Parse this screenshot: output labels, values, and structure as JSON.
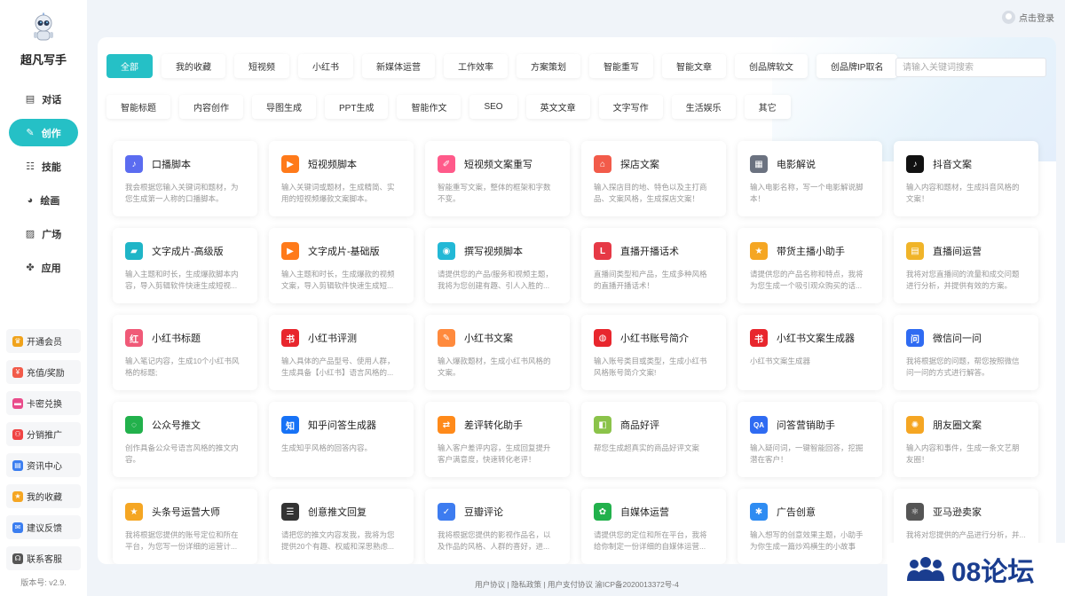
{
  "app": {
    "name": "超凡写手",
    "version": "版本号: v2.9."
  },
  "nav": [
    {
      "label": "对话",
      "icon": "chat-icon",
      "glyph": "▤"
    },
    {
      "label": "创作",
      "icon": "pen-icon",
      "glyph": "✎"
    },
    {
      "label": "技能",
      "icon": "skill-list-icon",
      "glyph": "☷"
    },
    {
      "label": "绘画",
      "icon": "palette-icon",
      "glyph": "◕"
    },
    {
      "label": "广场",
      "icon": "image-icon",
      "glyph": "▨"
    },
    {
      "label": "应用",
      "icon": "apps-icon",
      "glyph": "✤"
    }
  ],
  "side_items": [
    {
      "label": "开通会员",
      "icon": "crown-icon",
      "color": "#f0a31c",
      "glyph": "♛"
    },
    {
      "label": "充值/奖励",
      "icon": "recharge-icon",
      "color": "#f25b4a",
      "glyph": "¥"
    },
    {
      "label": "卡密兑换",
      "icon": "card-icon",
      "color": "#e94c8b",
      "glyph": "▬"
    },
    {
      "label": "分销推广",
      "icon": "share-icon",
      "color": "#ef4444",
      "glyph": "⚇"
    },
    {
      "label": "资讯中心",
      "icon": "news-icon",
      "color": "#3b7ef0",
      "glyph": "▤"
    },
    {
      "label": "我的收藏",
      "icon": "star-icon",
      "color": "#f5a623",
      "glyph": "★"
    },
    {
      "label": "建议反馈",
      "icon": "feedback-icon",
      "color": "#3b7ef0",
      "glyph": "✉"
    },
    {
      "label": "联系客服",
      "icon": "support-icon",
      "color": "#555555",
      "glyph": "☊"
    }
  ],
  "header": {
    "login_label": "点击登录"
  },
  "search": {
    "placeholder": "请输入关键词搜索"
  },
  "tabs_row1": [
    "全部",
    "我的收藏",
    "短视频",
    "小红书",
    "新媒体运营",
    "工作效率",
    "方案策划",
    "智能重写",
    "智能文章",
    "创品牌软文",
    "创品牌IP取名"
  ],
  "tabs_row2": [
    "智能标题",
    "内容创作",
    "导图生成",
    "PPT生成",
    "智能作文",
    "SEO",
    "英文文章",
    "文字写作",
    "生活娱乐",
    "其它"
  ],
  "cards": [
    {
      "title": "口播脚本",
      "desc": "我会根据您输入关键词和题材，为您生成第一人称的口播脚本。",
      "icon": "microphone-icon",
      "color": "#5b6cf0",
      "glyph": "♪"
    },
    {
      "title": "短视频脚本",
      "desc": "输入关键词或题材，生成精简、实用的短视频爆款文案脚本。",
      "icon": "video-play-icon",
      "color": "#ff7a1a",
      "glyph": "▶"
    },
    {
      "title": "短视频文案重写",
      "desc": "智能重写文案，整体的框架和字数不变。",
      "icon": "eraser-icon",
      "color": "#ff5a8a",
      "glyph": "✐"
    },
    {
      "title": "探店文案",
      "desc": "输入探店目的地、特色以及主打商品、文案风格，生成探店文案！",
      "icon": "shop-icon",
      "color": "#f25b4a",
      "glyph": "⌂"
    },
    {
      "title": "电影解说",
      "desc": "输入电影名称，写一个电影解说脚本！",
      "icon": "film-icon",
      "color": "#6b7280",
      "glyph": "▦"
    },
    {
      "title": "抖音文案",
      "desc": "输入内容和题材，生成抖音风格的文案！",
      "icon": "douyin-icon",
      "color": "#111111",
      "glyph": "♪"
    },
    {
      "title": "文字成片-高级版",
      "desc": "输入主题和时长，生成爆款脚本内容，导入剪辑软件快速生成短视...",
      "icon": "clapper-icon",
      "color": "#1fb5c7",
      "glyph": "▰"
    },
    {
      "title": "文字成片-基础版",
      "desc": "输入主题和时长，生成爆款的视频文案，导入剪辑软件快速生成短...",
      "icon": "video-play-icon",
      "color": "#ff7a1a",
      "glyph": "▶"
    },
    {
      "title": "撰写视频脚本",
      "desc": "请提供您的产品/服务和视频主题，我将为您创建有趣、引人入胜的...",
      "icon": "camera-icon",
      "color": "#22b8d6",
      "glyph": "◉"
    },
    {
      "title": "直播开播话术",
      "desc": "直播间类型和产品，生成多种风格的直播开播话术！",
      "icon": "live-icon",
      "color": "#e63946",
      "glyph": "L"
    },
    {
      "title": "带货主播小助手",
      "desc": "请提供您的产品名称和特点，我将为您生成一个吸引观众购买的话...",
      "icon": "star-badge-icon",
      "color": "#f5a623",
      "glyph": "★"
    },
    {
      "title": "直播间运营",
      "desc": "我将对您直播间的流量和成交问题进行分析，并提供有效的方案。",
      "icon": "clipboard-icon",
      "color": "#f0b429",
      "glyph": "▤"
    },
    {
      "title": "小红书标题",
      "desc": "输入笔记内容，生成10个小红书风格的标题;",
      "icon": "xiaohongshu-icon",
      "color": "#f05a78",
      "glyph": "红"
    },
    {
      "title": "小红书评测",
      "desc": "输入具体的产品型号、使用人群，生成具备【小红书】语言风格的...",
      "icon": "xiaohongshu-badge-icon",
      "color": "#e8262d",
      "glyph": "书"
    },
    {
      "title": "小红书文案",
      "desc": "输入爆款题材，生成小红书风格的文案。",
      "icon": "edit-icon",
      "color": "#ff8a3d",
      "glyph": "✎"
    },
    {
      "title": "小红书账号简介",
      "desc": "输入账号类目或类型，生成小红书风格账号简介文案!",
      "icon": "profile-icon",
      "color": "#e8262d",
      "glyph": "◍"
    },
    {
      "title": "小红书文案生成器",
      "desc": "小红书文案生成器",
      "icon": "xiaohongshu-round-icon",
      "color": "#e8262d",
      "glyph": "书"
    },
    {
      "title": "微信问一问",
      "desc": "我将根据您的问题，帮您按照微信问一问的方式进行解答。",
      "icon": "wechat-ask-icon",
      "color": "#2f6bf2",
      "glyph": "问"
    },
    {
      "title": "公众号推文",
      "desc": "创作具备公众号语言风格的推文内容。",
      "icon": "wechat-official-icon",
      "color": "#22b14c",
      "glyph": "◌"
    },
    {
      "title": "知乎问答生成器",
      "desc": "生成知乎风格的回答内容。",
      "icon": "zhihu-icon",
      "color": "#1772f6",
      "glyph": "知"
    },
    {
      "title": "差评转化助手",
      "desc": "输入客户差评内容，生成回复提升客户满意度，快速转化老评！",
      "icon": "convert-icon",
      "color": "#ff8a1a",
      "glyph": "⇄"
    },
    {
      "title": "商品好评",
      "desc": "帮您生成超真实的商品好评文案",
      "icon": "shopping-bag-icon",
      "color": "#8bc34a",
      "glyph": "◧"
    },
    {
      "title": "问答营销助手",
      "desc": "输入疑问词，一键智能回答，挖掘潜在客户！",
      "icon": "qa-icon",
      "color": "#2f6bf2",
      "glyph": "QA"
    },
    {
      "title": "朋友圈文案",
      "desc": "输入内容和事件，生成一条文艺朋友圈！",
      "icon": "moments-icon",
      "color": "#f5a623",
      "glyph": "✺"
    },
    {
      "title": "头条号运营大师",
      "desc": "我将根据您提供的账号定位和所在平台，为您写一份详细的运营计...",
      "icon": "star-badge-icon",
      "color": "#f5a623",
      "glyph": "★"
    },
    {
      "title": "创意推文回复",
      "desc": "请把您的推文内容发我，我将为您提供20个有趣、权威和深思熟虑...",
      "icon": "message-icon",
      "color": "#333333",
      "glyph": "☰"
    },
    {
      "title": "豆瓣评论",
      "desc": "我将根据您提供的影视作品名，以及作品的风格、人群的喜好，进...",
      "icon": "douban-icon",
      "color": "#3d7cf0",
      "glyph": "✓"
    },
    {
      "title": "自媒体运营",
      "desc": "请提供您的定位和所在平台，我将给你制定一份详细的自媒体运营...",
      "icon": "flower-icon",
      "color": "#22b14c",
      "glyph": "✿"
    },
    {
      "title": "广告创意",
      "desc": "输入想写的创意效果主题，小助手为你生成一篇炒鸡横生的小故事",
      "icon": "settings-badge-icon",
      "color": "#2f8cf2",
      "glyph": "✱"
    },
    {
      "title": "亚马逊卖家",
      "desc": "我将对您提供的产品进行分析，并...",
      "icon": "atom-icon",
      "color": "#555555",
      "glyph": "⚛"
    }
  ],
  "footer": {
    "text": "用户协议 | 隐私政策 | 用户支付协议   渝ICP备2020013372号-4"
  },
  "watermark": {
    "text": "08论坛"
  }
}
